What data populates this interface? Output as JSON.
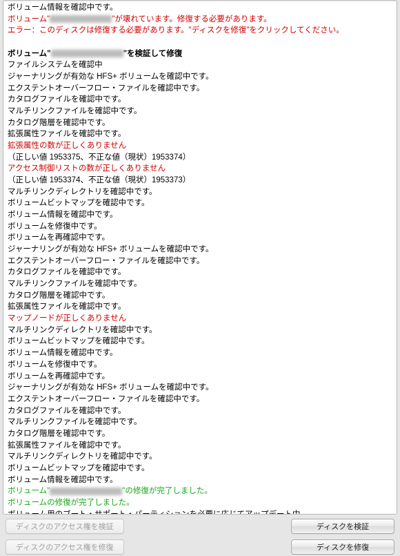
{
  "log": [
    {
      "text": "ボリューム情報を確認中です。",
      "cls": ""
    },
    {
      "text": [
        "ボリューム\"",
        {
          "blur": "w1"
        },
        "\"が壊れています。修復する必要があります。"
      ],
      "cls": "red"
    },
    {
      "text": "エラー：このディスクは修復する必要があります。\"ディスクを修復\"をクリックしてください。",
      "cls": "red"
    },
    {
      "text": "",
      "cls": ""
    },
    {
      "text": [
        "ボリューム\"",
        {
          "blur": "w2"
        },
        "\"を検証して修復"
      ],
      "cls": "bold"
    },
    {
      "text": "ファイルシステムを確認中",
      "cls": ""
    },
    {
      "text": "ジャーナリングが有効な HFS+ ボリュームを確認中です。",
      "cls": ""
    },
    {
      "text": "エクステントオーバーフロー・ファイルを確認中です。",
      "cls": ""
    },
    {
      "text": "カタログファイルを確認中です。",
      "cls": ""
    },
    {
      "text": "マルチリンクファイルを確認中です。",
      "cls": ""
    },
    {
      "text": "カタログ階層を確認中です。",
      "cls": ""
    },
    {
      "text": "拡張属性ファイルを確認中です。",
      "cls": ""
    },
    {
      "text": "拡張属性の数が正しくありません",
      "cls": "red"
    },
    {
      "text": "（正しい値 1953375、不正な値（現状）1953374）",
      "cls": ""
    },
    {
      "text": "アクセス制御リストの数が正しくありません",
      "cls": "red"
    },
    {
      "text": "（正しい値 1953374、不正な値（現状）1953373）",
      "cls": ""
    },
    {
      "text": "マルチリンクディレクトリを確認中です。",
      "cls": ""
    },
    {
      "text": "ボリュームビットマップを確認中です。",
      "cls": ""
    },
    {
      "text": "ボリューム情報を確認中です。",
      "cls": ""
    },
    {
      "text": "ボリュームを修復中です。",
      "cls": ""
    },
    {
      "text": "ボリュームを再確認中です。",
      "cls": ""
    },
    {
      "text": "ジャーナリングが有効な HFS+ ボリュームを確認中です。",
      "cls": ""
    },
    {
      "text": "エクステントオーバーフロー・ファイルを確認中です。",
      "cls": ""
    },
    {
      "text": "カタログファイルを確認中です。",
      "cls": ""
    },
    {
      "text": "マルチリンクファイルを確認中です。",
      "cls": ""
    },
    {
      "text": "カタログ階層を確認中です。",
      "cls": ""
    },
    {
      "text": "拡張属性ファイルを確認中です。",
      "cls": ""
    },
    {
      "text": "マップノードが正しくありません",
      "cls": "red"
    },
    {
      "text": "マルチリンクディレクトリを確認中です。",
      "cls": ""
    },
    {
      "text": "ボリュームビットマップを確認中です。",
      "cls": ""
    },
    {
      "text": "ボリューム情報を確認中です。",
      "cls": ""
    },
    {
      "text": "ボリュームを修復中です。",
      "cls": ""
    },
    {
      "text": "ボリュームを再確認中です。",
      "cls": ""
    },
    {
      "text": "ジャーナリングが有効な HFS+ ボリュームを確認中です。",
      "cls": ""
    },
    {
      "text": "エクステントオーバーフロー・ファイルを確認中です。",
      "cls": ""
    },
    {
      "text": "カタログファイルを確認中です。",
      "cls": ""
    },
    {
      "text": "マルチリンクファイルを確認中です。",
      "cls": ""
    },
    {
      "text": "カタログ階層を確認中です。",
      "cls": ""
    },
    {
      "text": "拡張属性ファイルを確認中です。",
      "cls": ""
    },
    {
      "text": "マルチリンクディレクトリを確認中です。",
      "cls": ""
    },
    {
      "text": "ボリュームビットマップを確認中です。",
      "cls": ""
    },
    {
      "text": "ボリューム情報を確認中です。",
      "cls": ""
    },
    {
      "text": [
        "ボリューム\"",
        {
          "blur": "w2"
        },
        "\"の修復が完了しました。"
      ],
      "cls": "green"
    },
    {
      "text": "ボリュームの修復が完了しました。",
      "cls": "green"
    },
    {
      "text": "ボリューム用のブート・サポート・パーティションを必要に応じてアップデート中。",
      "cls": ""
    }
  ],
  "buttons": {
    "verify_perms": "ディスクのアクセス権を検証",
    "repair_perms": "ディスクのアクセス権を修復",
    "verify_disk": "ディスクを検証",
    "repair_disk": "ディスクを修復"
  }
}
